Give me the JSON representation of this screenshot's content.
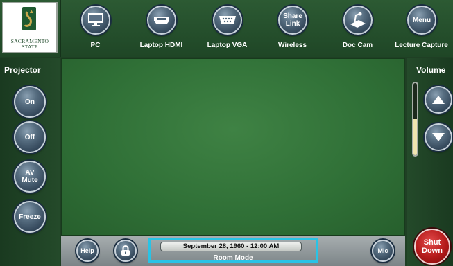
{
  "header": {
    "logo": {
      "line1": "SACRAMENTO",
      "line2": "STATE"
    },
    "sources": [
      {
        "label": "PC",
        "icon": "monitor-icon",
        "button_text": ""
      },
      {
        "label": "Laptop HDMI",
        "icon": "hdmi-port-icon",
        "button_text": ""
      },
      {
        "label": "Laptop VGA",
        "icon": "vga-port-icon",
        "button_text": ""
      },
      {
        "label": "Wireless",
        "icon": "",
        "button_text": "Share Link"
      },
      {
        "label": "Doc Cam",
        "icon": "document-camera-icon",
        "button_text": ""
      },
      {
        "label": "Lecture Capture",
        "icon": "",
        "button_text": "Menu"
      }
    ]
  },
  "projector": {
    "title": "Projector",
    "buttons": [
      {
        "label": "On"
      },
      {
        "label": "Off"
      },
      {
        "label": "AV Mute"
      },
      {
        "label": "Freeze"
      }
    ]
  },
  "volume": {
    "title": "Volume",
    "level": 0.5,
    "up_icon": "triangle-up-icon",
    "down_icon": "triangle-down-icon"
  },
  "footer": {
    "help_label": "Help",
    "lock_icon": "lock-icon",
    "datetime": "September 28, 1960  -  12:00 AM",
    "room_mode": "Room Mode",
    "mic_label": "Mic"
  },
  "shutdown": {
    "label": "Shut Down"
  },
  "colors": {
    "background": "#1f3f24",
    "content": "#2f6f36",
    "button": "#3c5163",
    "highlight": "#29c3e6",
    "shutdown": "#b41a1a",
    "volume_fill": "#f0e6b0"
  }
}
